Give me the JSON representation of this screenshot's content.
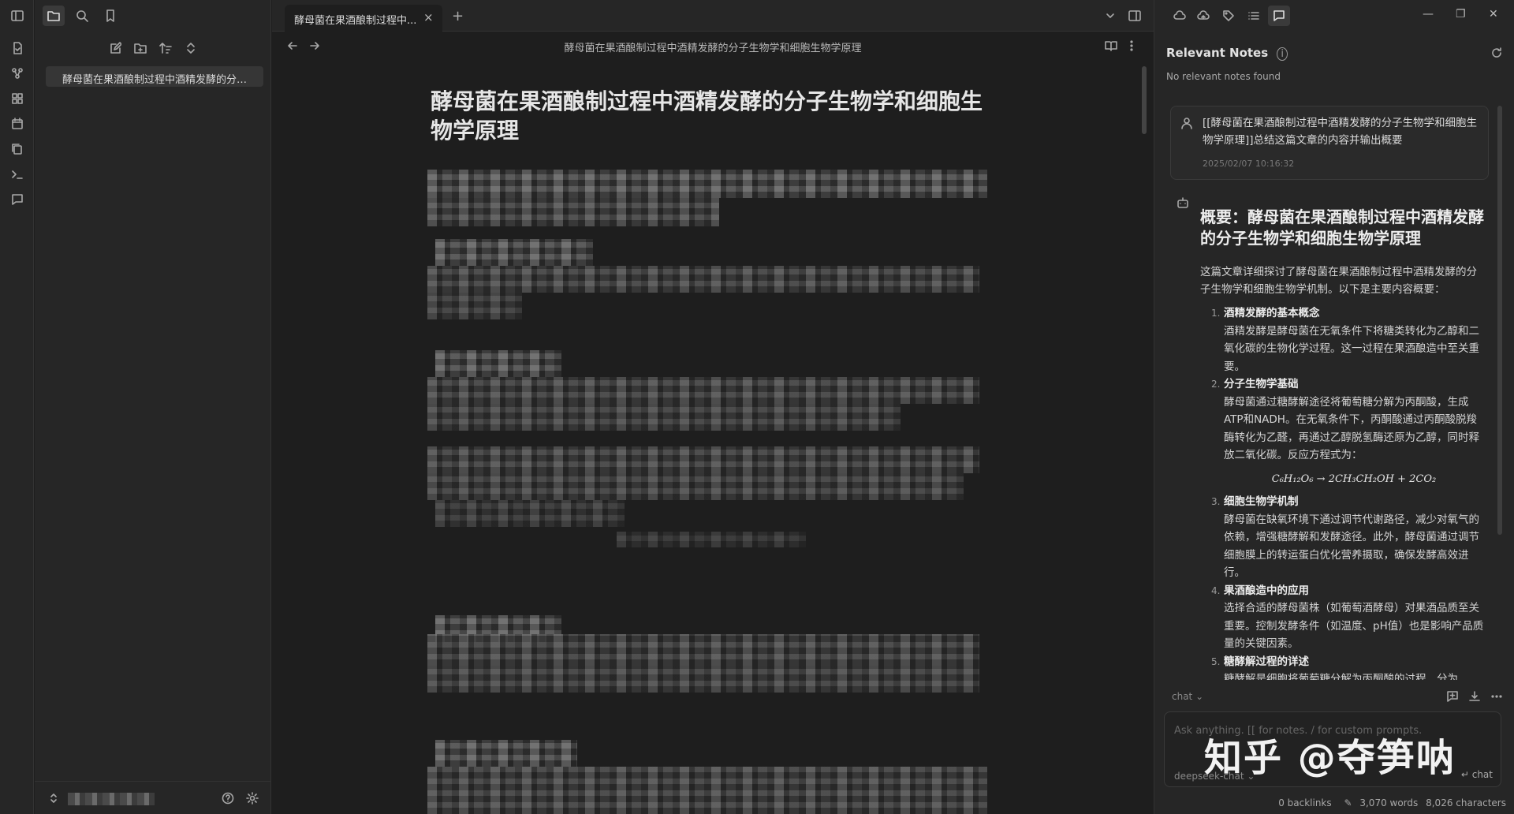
{
  "sidebar": {
    "file_name": "酵母菌在果酒酿制过程中酒精发酵的分子...",
    "vault_name": ""
  },
  "tab": {
    "label": "酵母菌在果酒酿制过程中...",
    "close": "×",
    "add": "+"
  },
  "editor": {
    "view_title": "酵母菌在果酒酿制过程中酒精发酵的分子生物学和细胞生物学原理",
    "doc_title": "酵母菌在果酒酿制过程中酒精发酵的分子生物学和细胞生物学原理"
  },
  "right_panel": {
    "relevant_heading": "Relevant Notes",
    "relevant_sub": "No relevant notes found",
    "user_message": "[[酵母菌在果酒酿制过程中酒精发酵的分子生物学和细胞生物学原理]]总结这篇文章的内容并输出概要",
    "user_timestamp": "2025/02/07 10:16:32",
    "ai_title": "概要：酵母菌在果酒酿制过程中酒精发酵的分子生物学和细胞生物学原理",
    "ai_intro": "这篇文章详细探讨了酵母菌在果酒酿制过程中酒精发酵的分子生物学和细胞生物学机制。以下是主要内容概要：",
    "items": [
      {
        "num": "1.",
        "title": "酒精发酵的基本概念",
        "text": "酒精发酵是酵母菌在无氧条件下将糖类转化为乙醇和二氧化碳的生物化学过程。这一过程在果酒酿造中至关重要。"
      },
      {
        "num": "2.",
        "title": "分子生物学基础",
        "text": "酵母菌通过糖酵解途径将葡萄糖分解为丙酮酸，生成ATP和NADH。在无氧条件下，丙酮酸通过丙酮酸脱羧酶转化为乙醛，再通过乙醇脱氢酶还原为乙醇，同时释放二氧化碳。反应方程式为："
      },
      {
        "num": "3.",
        "title": "细胞生物学机制",
        "text": "酵母菌在缺氧环境下通过调节代谢路径，减少对氧气的依赖，增强糖酵解和发酵途径。此外，酵母菌通过调节细胞膜上的转运蛋白优化营养摄取，确保发酵高效进行。"
      },
      {
        "num": "4.",
        "title": "果酒酿造中的应用",
        "text": "选择合适的酵母菌株（如葡萄酒酵母）对果酒品质至关重要。控制发酵条件（如温度、pH值）也是影响产品质量的关键因素。"
      },
      {
        "num": "5.",
        "title": "糖酵解过程的详述",
        "text": "糖酵解是细胞将葡萄糖分解为丙酮酸的过程，分为"
      }
    ],
    "formula": "C₆H₁₂O₆ → 2CH₃CH₂OH + 2CO₂",
    "chat_mode": "chat",
    "input_placeholder": "Ask anything. [[ for notes. / for custom prompts.",
    "watermark": "知乎 @夺笋呐",
    "model": "deepseek-chat",
    "send_label": "↵ chat"
  },
  "status": {
    "backlinks": "0 backlinks",
    "words": "3,070 words",
    "characters": "8,026 characters"
  },
  "window_controls": {
    "minimize": "—",
    "restore": "❐",
    "close": "✕"
  }
}
